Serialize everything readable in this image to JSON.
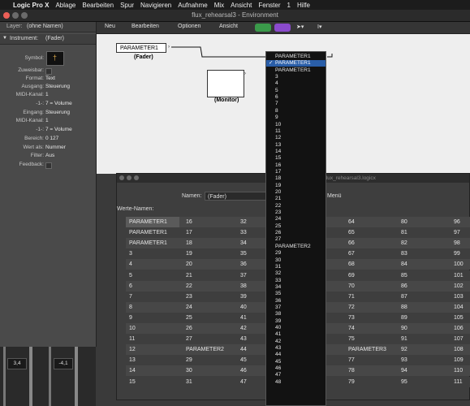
{
  "menubar": {
    "app": "Logic Pro X",
    "items": [
      "Ablage",
      "Bearbeiten",
      "Spur",
      "Navigieren",
      "Aufnahme",
      "Mix",
      "Ansicht",
      "Fenster",
      "1",
      "Hilfe"
    ]
  },
  "window": {
    "title": "flux_rehearsal3 - Environment"
  },
  "inspector": {
    "layer_label": "Layer:",
    "layer_value": "(ohne Namen)",
    "instrument_label": "Instrument:",
    "instrument_value": "(Fader)",
    "symbol_label": "Symbol:",
    "rows": [
      {
        "label": "Zuweisbar:",
        "value": ""
      },
      {
        "label": "Format:",
        "value": "Text"
      },
      {
        "label": "Ausgang:",
        "value": "Steuerung"
      },
      {
        "label": "MIDI-Kanal:",
        "value": "1"
      },
      {
        "label": "-1-:",
        "value": "7 = Volume"
      },
      {
        "label": "Eingang:",
        "value": "Steuerung"
      },
      {
        "label": "MIDI-Kanal:",
        "value": "1"
      },
      {
        "label": "-1-:",
        "value": "7 = Volume"
      },
      {
        "label": "Bereich:",
        "value": "0   127"
      },
      {
        "label": "Wert als:",
        "value": "Nummer"
      },
      {
        "label": "Filter:",
        "value": "Aus"
      },
      {
        "label": "Feedback:",
        "value": ""
      }
    ]
  },
  "toolbar": {
    "neu": "Neu",
    "bearbeiten": "Bearbeiten",
    "optionen": "Optionen",
    "ansicht": "Ansicht"
  },
  "canvas": {
    "fader_box": "PARAMETER1",
    "fader_label": "(Fader)",
    "monitor_label": "(Monitor)"
  },
  "dropdown": {
    "items": [
      "PARAMETER1",
      "PARAMETER1",
      "PARAMETER1",
      "3",
      "4",
      "5",
      "6",
      "7",
      "8",
      "9",
      "10",
      "11",
      "12",
      "13",
      "14",
      "15",
      "16",
      "17",
      "18",
      "19",
      "20",
      "21",
      "22",
      "23",
      "24",
      "25",
      "26",
      "27",
      "PARAMETER2",
      "29",
      "30",
      "31",
      "32",
      "33",
      "34",
      "35",
      "36",
      "37",
      "38",
      "39",
      "40",
      "41",
      "42",
      "43",
      "44",
      "45",
      "46",
      "47",
      "48"
    ],
    "selected_index": 1
  },
  "win2": {
    "title": "flux_rehearsal3.logicx",
    "namen_label": "Namen:",
    "namen_value": "(Fader)",
    "menu_label": "Menü",
    "werte_label": "Werte-Namen:",
    "col1": [
      "PARAMETER1",
      "PARAMETER1",
      "PARAMETER1",
      "3",
      "4",
      "5",
      "6",
      "7",
      "8",
      "9",
      "10",
      "11",
      "12",
      "13",
      "14",
      "15"
    ],
    "col2": [
      "16",
      "17",
      "18",
      "19",
      "20",
      "21",
      "22",
      "23",
      "24",
      "25",
      "26",
      "27",
      "PARAMETER2",
      "29",
      "30",
      "31"
    ],
    "col3": [
      "32",
      "33",
      "34",
      "35",
      "36",
      "37",
      "38",
      "39",
      "40",
      "41",
      "42",
      "43",
      "44",
      "45",
      "46",
      "47"
    ],
    "col4": [
      "64",
      "65",
      "66",
      "67",
      "68",
      "69",
      "70",
      "71",
      "72",
      "73",
      "74",
      "75",
      "PARAMETER3",
      "77",
      "78",
      "79"
    ],
    "col5": [
      "80",
      "81",
      "82",
      "83",
      "84",
      "85",
      "86",
      "87",
      "88",
      "89",
      "90",
      "91",
      "92",
      "93",
      "94",
      "95"
    ],
    "col6": [
      "96",
      "97",
      "98",
      "99",
      "100",
      "101",
      "102",
      "103",
      "104",
      "105",
      "106",
      "107",
      "108",
      "109",
      "110",
      "111"
    ]
  },
  "mixer": {
    "val1": "3,4",
    "val2": "-4,1"
  }
}
